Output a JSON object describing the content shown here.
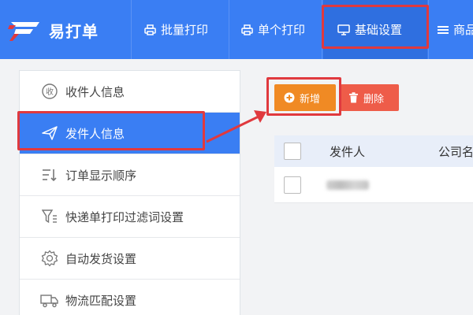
{
  "app": {
    "name": "易打单"
  },
  "nav": [
    {
      "label": "批量打印",
      "icon": "printer-icon"
    },
    {
      "label": "单个打印",
      "icon": "printer-icon"
    },
    {
      "label": "基础设置",
      "icon": "monitor-icon",
      "active": true
    },
    {
      "label": "商品",
      "icon": "list-icon"
    }
  ],
  "sidebar": {
    "items": [
      {
        "label": "收件人信息",
        "icon": "receive-icon"
      },
      {
        "label": "发件人信息",
        "icon": "send-icon",
        "active": true
      },
      {
        "label": "订单显示顺序",
        "icon": "sort-icon"
      },
      {
        "label": "快递单打印过滤词设置",
        "icon": "filter-icon"
      },
      {
        "label": "自动发货设置",
        "icon": "gear-icon"
      },
      {
        "label": "物流匹配设置",
        "icon": "truck-icon"
      }
    ]
  },
  "toolbar": {
    "add_label": "新增",
    "delete_label": "删除"
  },
  "table": {
    "columns": [
      "发件人",
      "公司名"
    ]
  },
  "colors": {
    "primary": "#3a7ef3",
    "add": "#f08a24",
    "delete": "#ee5c49",
    "highlight": "#e0393e"
  }
}
